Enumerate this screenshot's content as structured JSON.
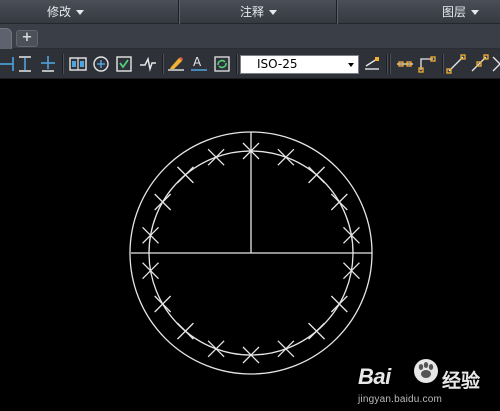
{
  "menubar": {
    "items": [
      {
        "label": "修改"
      },
      {
        "label": "注释"
      },
      {
        "label": "图层"
      }
    ]
  },
  "tabs": {
    "new_tab_label": "+"
  },
  "toolbar": {
    "dimension_style": "ISO-25",
    "icons": [
      "dim-linear-icon",
      "dim-vertical-icon",
      "dim-ordinate-icon",
      "dim-table-icon",
      "dim-center-mark-icon",
      "dim-inspect-icon",
      "dim-jogged-icon",
      "dim-edit-icon",
      "dim-text-edit-icon",
      "dim-update-icon",
      "dim-style-override-icon",
      "constraint-coincident-icon",
      "constraint-fix-icon",
      "constraint-parallel-icon",
      "constraint-perpendicular-icon",
      "constraint-more-icon"
    ]
  },
  "watermark": {
    "brand": "Bai",
    "brand_suffix": "经验",
    "url": "jingyan.baidu.com"
  },
  "colors": {
    "canvas_bg": "#000000",
    "line": "#e6e6e6",
    "ribbon_bg": "#3d424a"
  }
}
